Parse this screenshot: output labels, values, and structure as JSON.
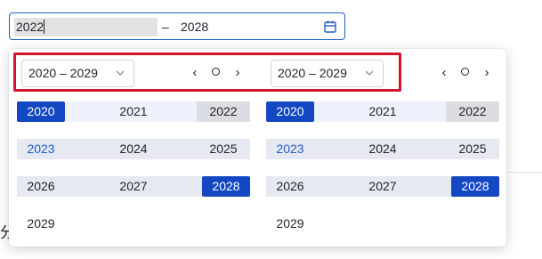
{
  "range_picker": {
    "start_value": "2022",
    "separator": "–",
    "end_value": "2028",
    "icon": "calendar-icon"
  },
  "background": {
    "partial_char": "分"
  },
  "panels": [
    {
      "decade_label": "2020 – 2029",
      "years": [
        [
          "2020",
          "2021",
          "2022"
        ],
        [
          "2023",
          "2024",
          "2025"
        ],
        [
          "2026",
          "2027",
          "2028"
        ],
        [
          "2029"
        ]
      ]
    },
    {
      "decade_label": "2020 – 2029",
      "years": [
        [
          "2020",
          "2021",
          "2022"
        ],
        [
          "2023",
          "2024",
          "2025"
        ],
        [
          "2026",
          "2027",
          "2028"
        ],
        [
          "2029"
        ]
      ]
    }
  ],
  "nav": {
    "prev": "‹",
    "next": "›"
  },
  "colors": {
    "accent": "#1348c2",
    "range_band": "#e6e8f2",
    "annotation": "#d2142a"
  }
}
